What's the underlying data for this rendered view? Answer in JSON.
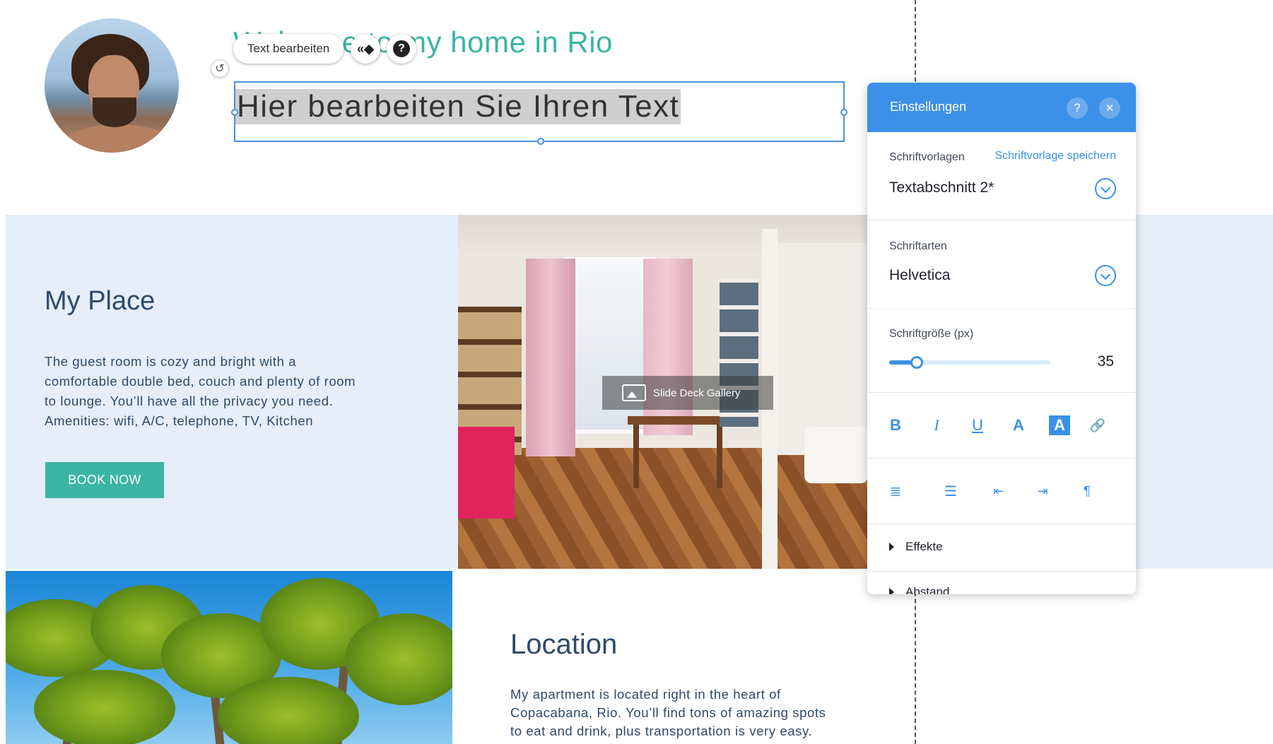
{
  "header": {
    "heading_text": "Welcome to my home in Rio",
    "edited_text": "Hier bearbeiten Sie Ihren Text"
  },
  "toolbar": {
    "edit_text_label": "Text bearbeiten",
    "animation_glyph": "«◆",
    "help_glyph": "?",
    "undo_glyph": "↺"
  },
  "my_place": {
    "title": "My Place",
    "lines": [
      "The guest room is cozy and bright with a",
      "comfortable double bed, couch and plenty of room",
      "to lounge. You’ll have all the privacy you need.",
      "Amenities: wifi, A/C, telephone, TV, Kitchen"
    ],
    "button_label": "BOOK NOW"
  },
  "gallery": {
    "label": "Slide Deck Gallery"
  },
  "location": {
    "title": "Location",
    "lines": [
      "My apartment is located right in the heart of",
      "Copacabana, Rio. You’ll find tons of amazing spots",
      "to eat and drink, plus transportation is very easy."
    ]
  },
  "settings": {
    "title": "Einstellungen",
    "help_glyph": "?",
    "close_glyph": "✕",
    "styles_label": "Schriftvorlagen",
    "save_style_link": "Schriftvorlage speichern",
    "style_value": "Textabschnitt 2*",
    "fonts_label": "Schriftarten",
    "font_value": "Helvetica",
    "size_label": "Schriftgröße (px)",
    "size_value": "35",
    "size_slider_fraction": 0.17,
    "format": {
      "bold": "B",
      "italic": "I",
      "underline": "U",
      "text_color": "A",
      "highlight": "A",
      "link": "🔗"
    },
    "effects_label": "Effekte",
    "spacing_label": "Abstand"
  },
  "colors": {
    "accent": "#3cb5a3",
    "panel_header": "#3b90e8",
    "band": "#e5eef9",
    "text": "#2e4a6a"
  }
}
